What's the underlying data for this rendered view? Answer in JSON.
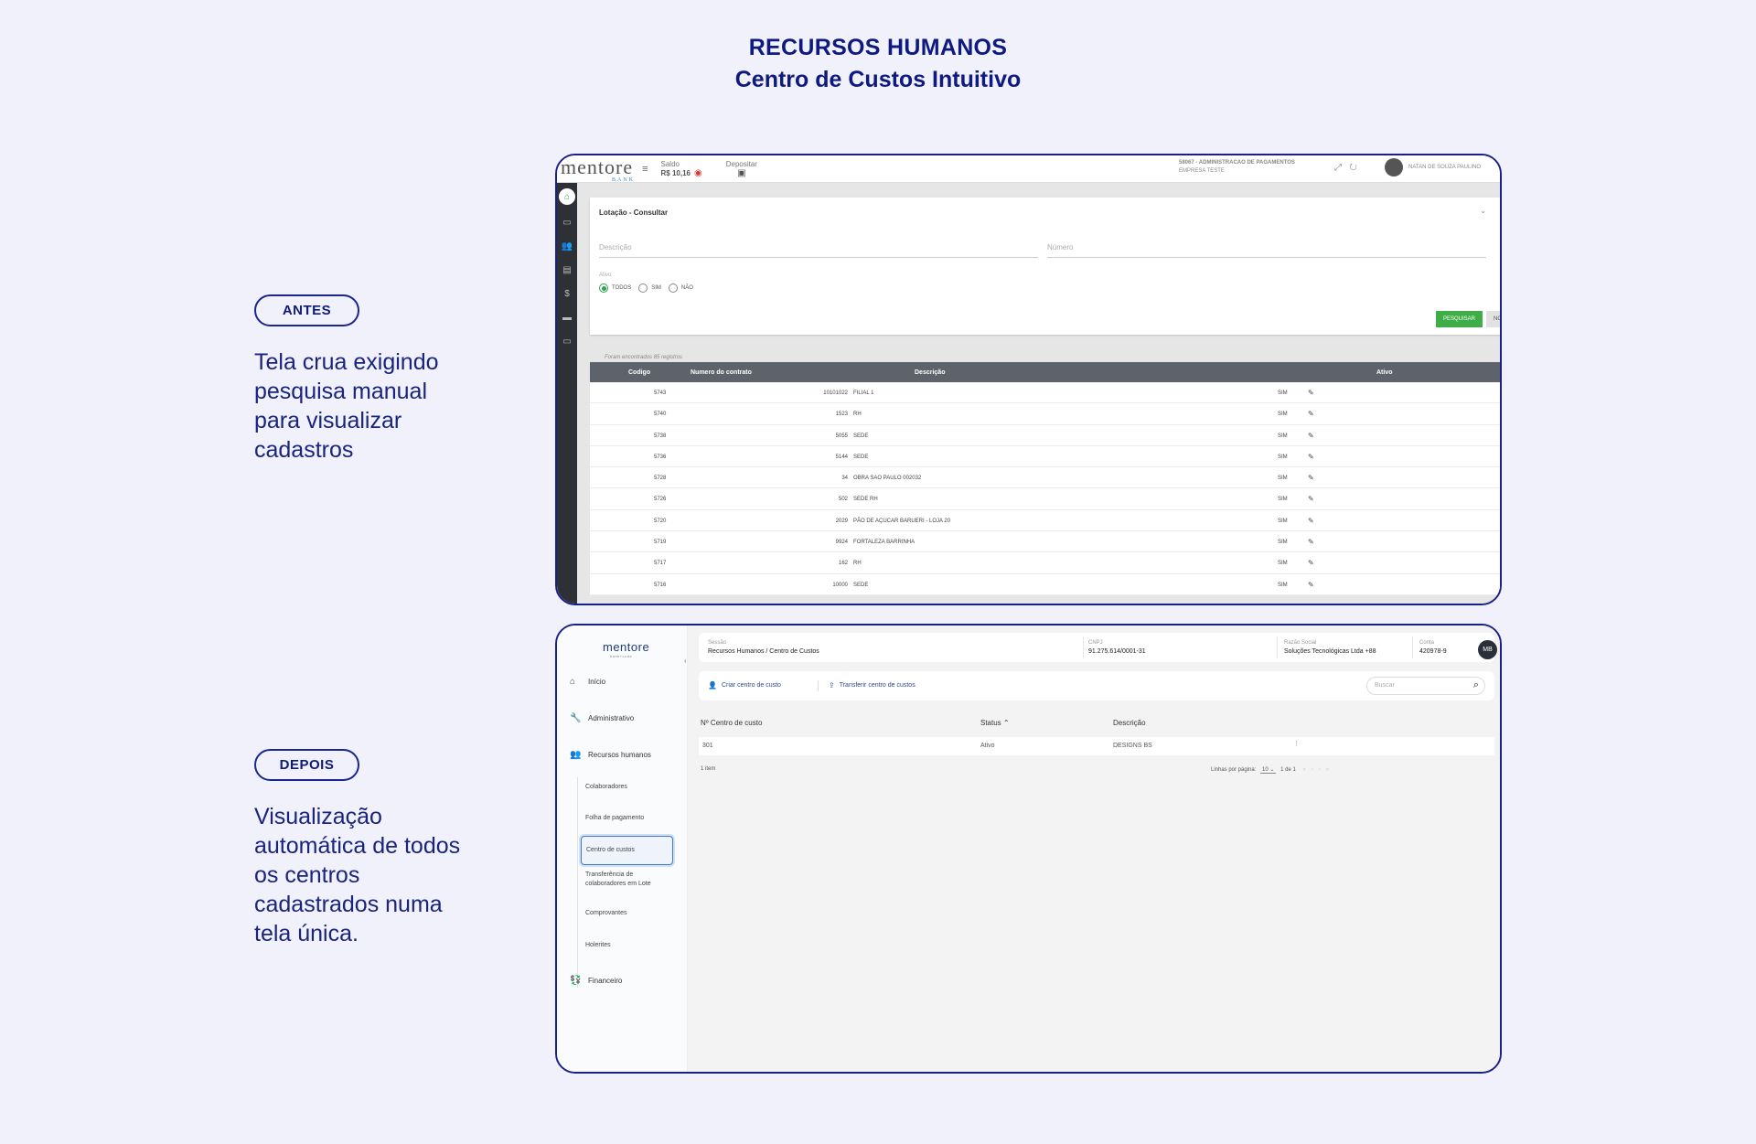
{
  "page": {
    "title_line1": "RECURSOS HUMANOS",
    "title_line2": "Centro de Custos Intuitivo"
  },
  "labels": {
    "before": "ANTES",
    "before_text": "Tela crua exigindo pesquisa manual para visualizar cadastros",
    "after": "DEPOIS",
    "after_text": "Visualização automática de todos os centros cadastrados numa tela única."
  },
  "before_screen": {
    "logo": "mentore",
    "logo_sub": "BANK",
    "saldo_label": "Saldo",
    "saldo_value": "R$ 10,16",
    "depositar_label": "Depositar",
    "company_line1": "58067 - ADMINISTRACAO DE PAGAMENTOS",
    "company_line2": "EMPRESA TESTE",
    "user_name": "NATAN DE SOUZA PAULINO",
    "card_title": "Lotação - Consultar",
    "field_descricao": "Descrição",
    "field_numero": "Número",
    "ativo_label": "Ativo",
    "radio_todos": "TODOS",
    "radio_sim": "SIM",
    "radio_nao": "NÃO",
    "btn_pesquisar": "PESQUISAR",
    "btn_novo": "NOVO",
    "found_text": "Foram encontrados 85 registros",
    "columns": [
      "Codigo",
      "Numero do contrato",
      "Descrição",
      "Ativo"
    ],
    "rows": [
      {
        "codigo": "5743",
        "numero": "10101022",
        "descricao": "FILIAL 1",
        "ativo": "SIM"
      },
      {
        "codigo": "5740",
        "numero": "1523",
        "descricao": "RH",
        "ativo": "SIM"
      },
      {
        "codigo": "5738",
        "numero": "5055",
        "descricao": "SEDE",
        "ativo": "SIM"
      },
      {
        "codigo": "5736",
        "numero": "5144",
        "descricao": "SEDE",
        "ativo": "SIM"
      },
      {
        "codigo": "5728",
        "numero": "34",
        "descricao": "OBRA SAO PAULO 002032",
        "ativo": "SIM"
      },
      {
        "codigo": "5726",
        "numero": "502",
        "descricao": "SEDE RH",
        "ativo": "SIM"
      },
      {
        "codigo": "5720",
        "numero": "2029",
        "descricao": "PÃO DE AÇUCAR BARUERI - LOJA 20",
        "ativo": "SIM"
      },
      {
        "codigo": "5719",
        "numero": "9924",
        "descricao": "FORTALEZA BARRINHA",
        "ativo": "SIM"
      },
      {
        "codigo": "5717",
        "numero": "162",
        "descricao": "RH",
        "ativo": "SIM"
      },
      {
        "codigo": "5716",
        "numero": "10000",
        "descricao": "SEDE",
        "ativo": "SIM"
      }
    ]
  },
  "after_screen": {
    "logo": "mentore",
    "logo_sub": "bank+code",
    "nav": {
      "inicio": "Início",
      "administrativo": "Administrativo",
      "recursos_humanos": "Recursos humanos",
      "colaboradores": "Colaboradores",
      "folha": "Folha de pagamento",
      "centro": "Centro de custos",
      "transferencia": "Transferência de colaboradores em Lote",
      "comprovantes": "Comprovantes",
      "holerites": "Holerites",
      "financeiro": "Financeiro"
    },
    "header": {
      "sessao_label": "Sessão",
      "sessao_value": "Recursos Humanos / Centro de Custos",
      "cnpj_label": "CNPJ",
      "cnpj_value": "91.275.614/0001-31",
      "razao_label": "Razão Social",
      "razao_value": "Soluções Tecnológicas Ltda +88",
      "conta_label": "Conta",
      "conta_value": "420978-9",
      "avatar": "MB"
    },
    "toolbar": {
      "criar": "Criar centro de custo",
      "transferir": "Transferir centro de custos",
      "search_placeholder": "Buscar"
    },
    "columns": [
      "Nº Centro de custo",
      "Status ⌃",
      "Descrição"
    ],
    "rows": [
      {
        "numero": "301",
        "status": "Ativo",
        "descricao": "DESIGNS BS"
      }
    ],
    "footer": {
      "count": "1 item",
      "per_page_label": "Linhas por página:",
      "per_page_value": "10",
      "range": "1 de 1"
    }
  }
}
